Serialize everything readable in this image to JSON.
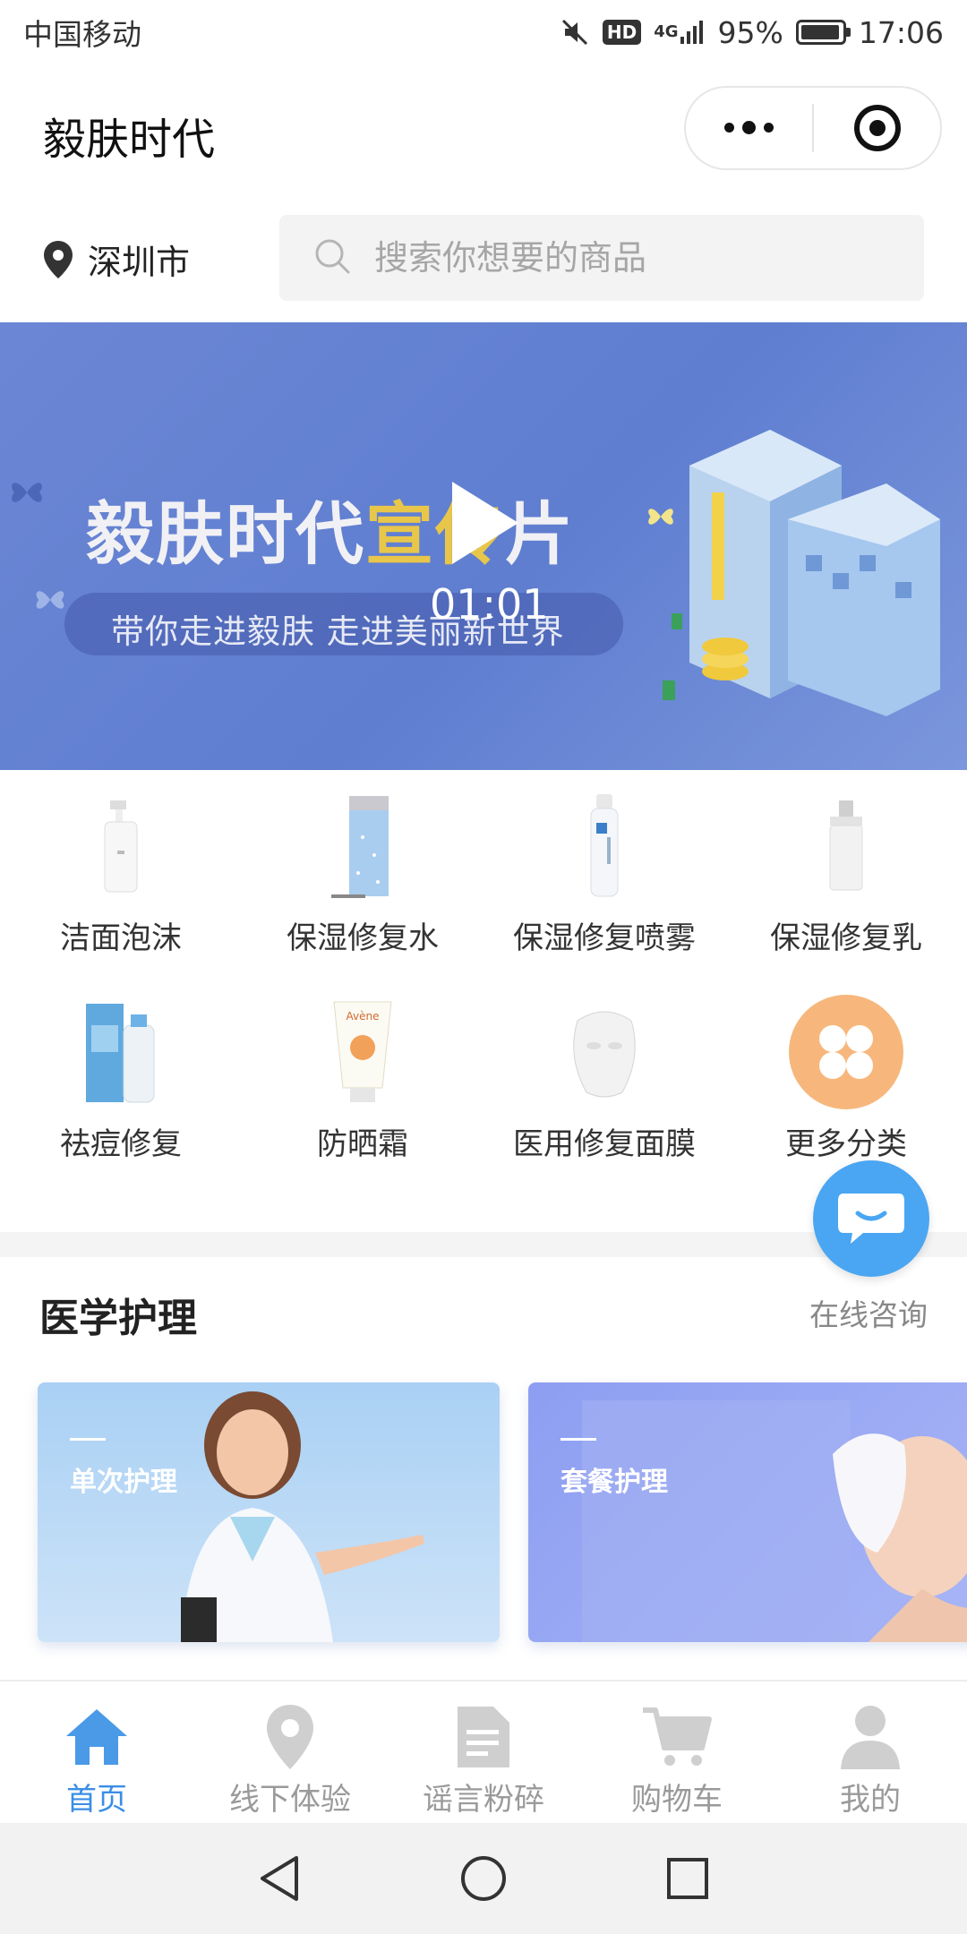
{
  "status_bar": {
    "carrier": "中国移动",
    "hd": "HD",
    "network": "4G",
    "battery": "95%",
    "battery_level": 0.95,
    "time": "17:06"
  },
  "title_bar": {
    "title": "毅肤时代"
  },
  "location": {
    "city": "深圳市"
  },
  "search": {
    "placeholder": "搜索你想要的商品",
    "value": ""
  },
  "banner": {
    "title_part1": "毅肤时代",
    "title_highlight": "宣传",
    "title_part3": "片",
    "subtitle": "带你走进毅肤  走进美丽新世界",
    "duration": "01:01"
  },
  "categories": [
    {
      "label": "洁面泡沫",
      "icon": "foam-bottle-icon"
    },
    {
      "label": "保湿修复水",
      "icon": "toner-bottle-icon"
    },
    {
      "label": "保湿修复喷雾",
      "icon": "spray-bottle-icon"
    },
    {
      "label": "保湿修复乳",
      "icon": "lotion-bottle-icon"
    },
    {
      "label": "祛痘修复",
      "icon": "acne-box-icon"
    },
    {
      "label": "防晒霜",
      "icon": "sunscreen-tube-icon"
    },
    {
      "label": "医用修复面膜",
      "icon": "face-mask-icon"
    },
    {
      "label": "更多分类",
      "icon": "more-grid-icon"
    }
  ],
  "medical_section": {
    "title": "医学护理",
    "consult_label": "在线咨询",
    "cards": [
      {
        "title": "单次护理"
      },
      {
        "title": "套餐护理"
      }
    ]
  },
  "tabbar": {
    "items": [
      {
        "label": "首页",
        "icon": "home-icon",
        "active": true
      },
      {
        "label": "线下体验",
        "icon": "map-pin-icon",
        "active": false
      },
      {
        "label": "谣言粉碎",
        "icon": "document-icon",
        "active": false
      },
      {
        "label": "购物车",
        "icon": "cart-icon",
        "active": false
      },
      {
        "label": "我的",
        "icon": "user-icon",
        "active": false
      }
    ]
  },
  "colors": {
    "accent": "#3a8ee6",
    "banner_bg": "#6b86d4",
    "highlight": "#e8c64a",
    "fab": "#4aa6f2"
  }
}
